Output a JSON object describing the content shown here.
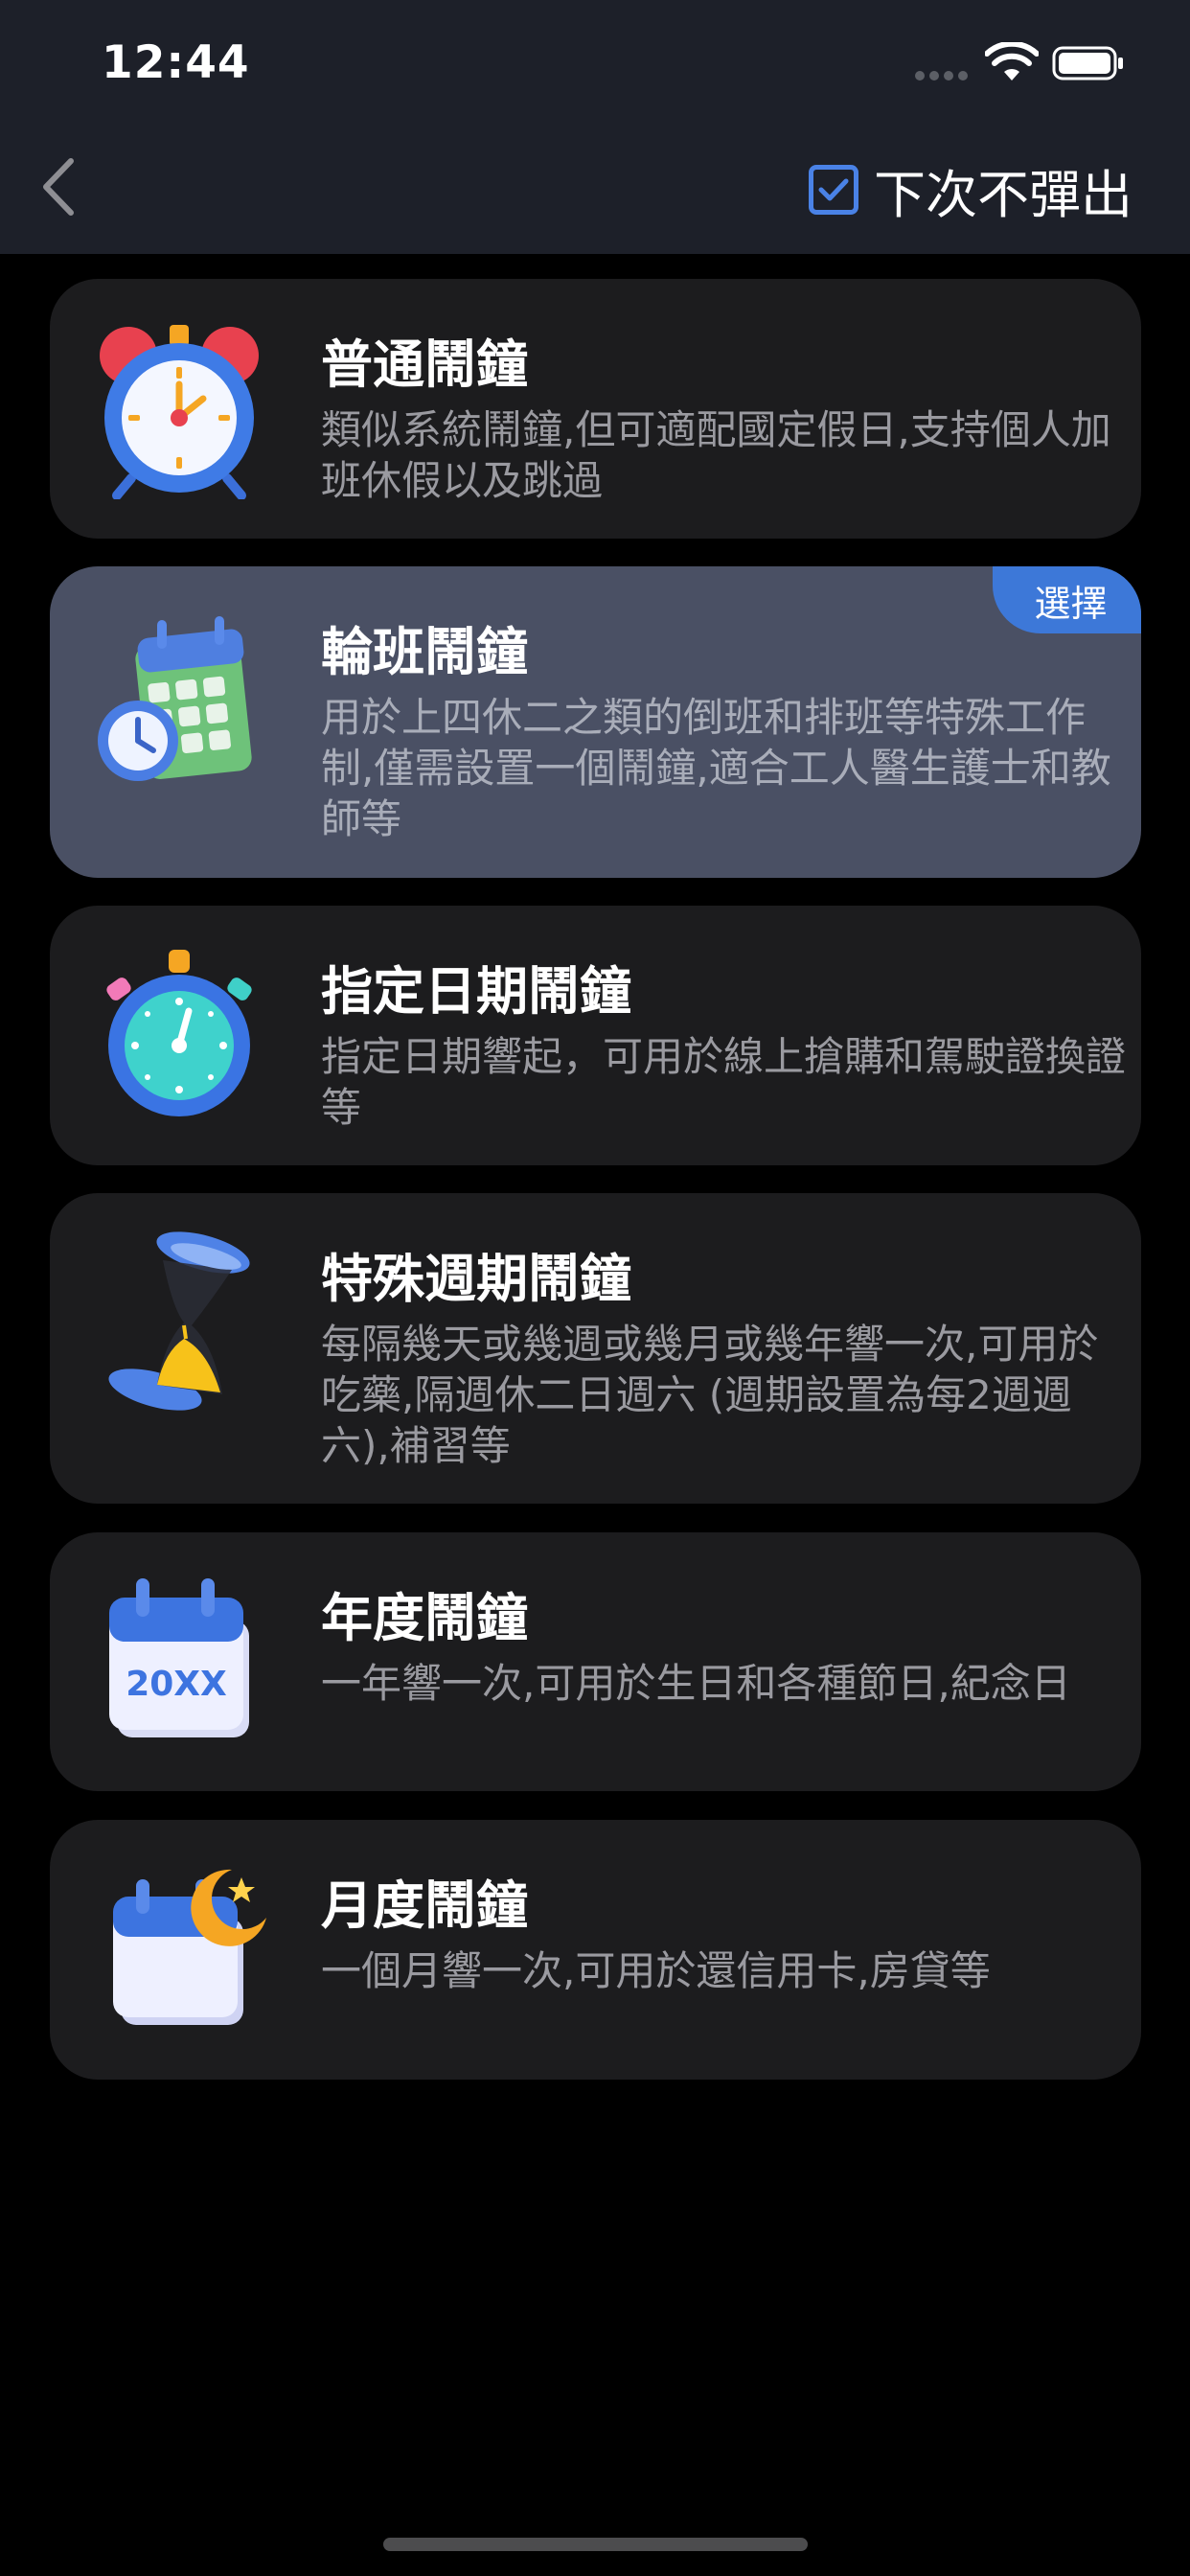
{
  "status_bar": {
    "time": "12:44"
  },
  "nav": {
    "dont_show_label": "下次不彈出",
    "dont_show_checked": true
  },
  "cards": [
    {
      "title": "普通鬧鐘",
      "desc": "類似系統鬧鐘,但可適配國定假日,支持個人加班休假以及跳過",
      "icon": "alarm-clock-icon",
      "selected": false
    },
    {
      "title": "輪班鬧鐘",
      "desc": "用於上四休二之類的倒班和排班等特殊工作制,僅需設置一個鬧鐘,適合工人醫生護士和教師等",
      "icon": "calendar-clock-icon",
      "selected": true,
      "badge": "選擇"
    },
    {
      "title": "指定日期鬧鐘",
      "desc": "指定日期響起，可用於線上搶購和駕駛證換證等",
      "icon": "stopwatch-icon",
      "selected": false
    },
    {
      "title": "特殊週期鬧鐘",
      "desc": "每隔幾天或幾週或幾月或幾年響一次,可用於吃藥,隔週休二日週六 (週期設置為每2週週六),補習等",
      "icon": "hourglass-icon",
      "selected": false
    },
    {
      "title": "年度鬧鐘",
      "desc": "一年響一次,可用於生日和各種節日,紀念日",
      "icon": "yearly-calendar-icon",
      "icon_text": "20XX",
      "selected": false
    },
    {
      "title": "月度鬧鐘",
      "desc": "一個月響一次,可用於還信用卡,房貸等",
      "icon": "monthly-calendar-moon-icon",
      "selected": false
    }
  ],
  "colors": {
    "header_bg": "#1d2029",
    "card_bg": "#1c1c1e",
    "selected_card_bg": "#4a5064",
    "accent": "#3d78d8"
  }
}
